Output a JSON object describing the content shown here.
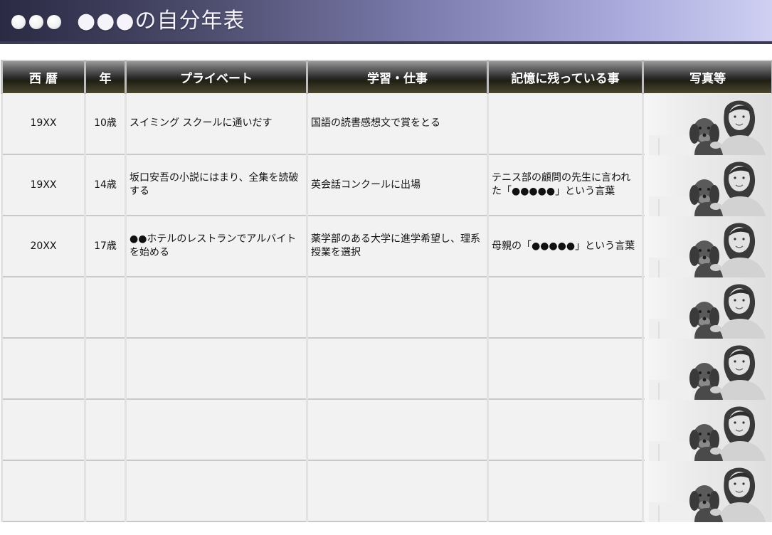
{
  "page": {
    "title": "●●●の自分年表"
  },
  "table": {
    "headers": [
      "西 暦",
      "年",
      "プライベート",
      "学習・仕事",
      "記憶に残っている事",
      "写真等"
    ],
    "rows": [
      {
        "year": "19XX",
        "age": "10歳",
        "private": "スイミング スクールに通いだす",
        "study": "国語の読書感想文で賞をとる",
        "memory": ""
      },
      {
        "year": "19XX",
        "age": "14歳",
        "private": "坂口安吾の小説にはまり、全集を読破する",
        "study": "英会話コンクールに出場",
        "memory": "テニス部の顧問の先生に言われた「●●●●●」という言葉"
      },
      {
        "year": "20XX",
        "age": "17歳",
        "private": "●●ホテルのレストランでアルバイトを始める",
        "study": "薬学部のある大学に進学希望し、理系授業を選択",
        "memory": "母親の「●●●●●」という言葉"
      },
      {
        "year": "",
        "age": "",
        "private": "",
        "study": "",
        "memory": ""
      },
      {
        "year": "",
        "age": "",
        "private": "",
        "study": "",
        "memory": ""
      },
      {
        "year": "",
        "age": "",
        "private": "",
        "study": "",
        "memory": ""
      },
      {
        "year": "",
        "age": "",
        "private": "",
        "study": "",
        "memory": ""
      }
    ],
    "photo_icon": "woman-with-dog-photo"
  }
}
